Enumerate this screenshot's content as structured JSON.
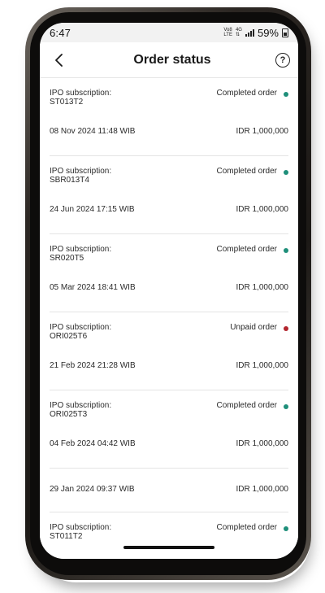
{
  "status_bar": {
    "time": "6:47",
    "net_top": "Vo8",
    "net_bottom": "LTE",
    "net_gen_top": "4G",
    "net_gen_bottom": "⇅",
    "battery_pct": "59%"
  },
  "header": {
    "title": "Order status",
    "help_label": "?"
  },
  "orders": [
    {
      "type": "IPO subscription:",
      "code": "ST013T2",
      "status": "Completed order",
      "status_color": "#1f8f7a",
      "date": "08 Nov 2024 11:48 WIB",
      "amount": "IDR 1,000,000"
    },
    {
      "type": "IPO subscription:",
      "code": "SBR013T4",
      "status": "Completed order",
      "status_color": "#1f8f7a",
      "date": "24 Jun 2024 17:15 WIB",
      "amount": "IDR 1,000,000"
    },
    {
      "type": "IPO subscription:",
      "code": "SR020T5",
      "status": "Completed order",
      "status_color": "#1f8f7a",
      "date": "05 Mar 2024 18:41 WIB",
      "amount": "IDR 1,000,000"
    },
    {
      "type": "IPO subscription:",
      "code": "ORI025T6",
      "status": "Unpaid order",
      "status_color": "#b3262e",
      "date": "21 Feb 2024 21:28 WIB",
      "amount": "IDR 1,000,000"
    },
    {
      "type": "IPO subscription:",
      "code": "ORI025T3",
      "status": "Completed order",
      "status_color": "#1f8f7a",
      "date": "04 Feb 2024 04:42 WIB",
      "amount": "IDR 1,000,000"
    },
    {
      "date": "29 Jan 2024 09:37 WIB",
      "amount": "IDR 1,000,000"
    },
    {
      "type": "IPO subscription:",
      "code": "ST011T2",
      "status": "Completed order",
      "status_color": "#1f8f7a"
    }
  ]
}
